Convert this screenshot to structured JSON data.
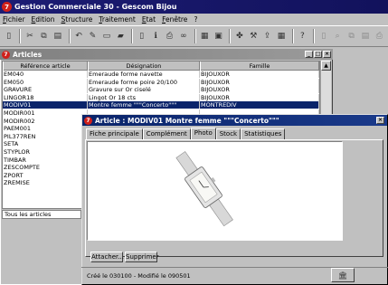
{
  "app": {
    "title": "Gestion Commerciale 30 - Gescom Bijou",
    "icon": "app-logo-icon"
  },
  "menu": [
    "Fichier",
    "Edition",
    "Structure",
    "Traitement",
    "Etat",
    "Fenêtre",
    "?"
  ],
  "toolbar": {
    "icons": [
      "new-icon",
      "cut-icon",
      "copy-icon",
      "paste-icon",
      "undo-icon",
      "pencil-icon",
      "edit-icon",
      "open-folder-icon",
      "document-icon",
      "info-icon",
      "print-icon",
      "binoculars-icon",
      "table-icon",
      "calendar-icon",
      "puzzle-icon",
      "tools-icon",
      "export-icon",
      "grid-icon",
      "help-icon",
      "doc-gray-icon",
      "search-gray-icon",
      "copy-gray-icon",
      "paste-gray-icon",
      "print-gray-icon",
      "ext-icon"
    ]
  },
  "articles_window": {
    "title": "Articles",
    "columns": [
      "Référence article",
      "Désignation",
      "Famille"
    ],
    "rows": [
      [
        "EM040",
        "Emeraude forme navette",
        "BIJOUXOR"
      ],
      [
        "EM050",
        "Emeraude forme poire 20/100",
        "BIJOUXOR"
      ],
      [
        "GRAVURE",
        "Gravure sur Or ciselé",
        "BIJOUXOR"
      ],
      [
        "LINGOR18",
        "Lingot Or 18 cts",
        "BIJOUXOR"
      ],
      [
        "MODIV01",
        "Montre femme \"\"\"Concerto\"\"\"",
        "MONTREDIV"
      ],
      [
        "MODIR001",
        "",
        ""
      ],
      [
        "MODIR002",
        "",
        ""
      ],
      [
        "PAEM001",
        "",
        ""
      ],
      [
        "PIL377REN",
        "",
        ""
      ],
      [
        "SETA",
        "",
        ""
      ],
      [
        "STYPLOR",
        "",
        ""
      ],
      [
        "TIMBAR",
        "",
        ""
      ],
      [
        "ZESCOMPTE",
        "",
        ""
      ],
      [
        "ZPORT",
        "",
        ""
      ],
      [
        "ZREMISE",
        "",
        ""
      ]
    ],
    "selected_index": 4,
    "filter": "Tous les articles"
  },
  "dialog": {
    "title": "Article : MODIV01 Montre femme \"\"\"Concerto\"\"\"",
    "tabs": [
      "Fiche principale",
      "Complément",
      "Photo",
      "Stock",
      "Statistiques"
    ],
    "active_tab": 2,
    "buttons": {
      "attach": "Attacher...",
      "delete": "Supprimer"
    },
    "status": "Créé le 030100 - Modifié le 090501"
  },
  "colors": {
    "title_active": "#0a246a",
    "title_app": "#1c1c74",
    "selection": "#0a246a"
  }
}
